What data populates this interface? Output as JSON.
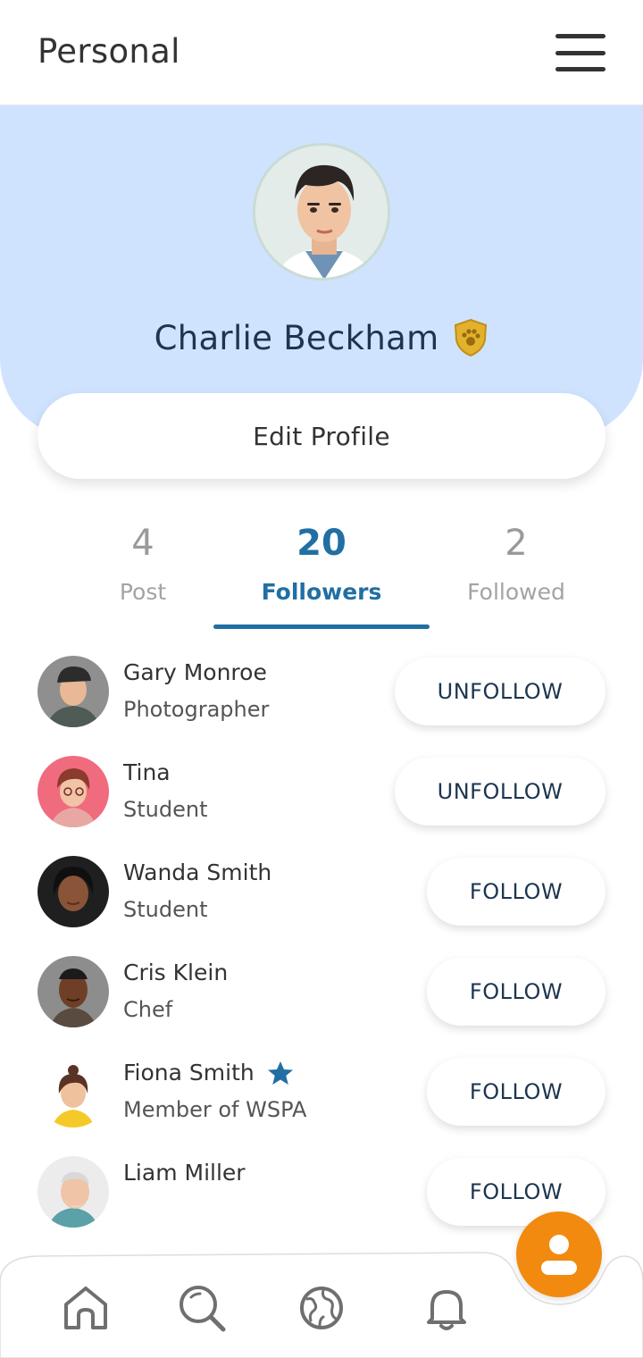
{
  "header": {
    "title": "Personal",
    "menu_icon": "hamburger-menu-icon"
  },
  "profile": {
    "name": "Charlie Beckham",
    "badge_icon": "gold-shield-paw-icon",
    "edit_label": "Edit Profile",
    "band_color": "#cfe3ff"
  },
  "stats": [
    {
      "count": "4",
      "label": "Post"
    },
    {
      "count": "20",
      "label": "Followers"
    },
    {
      "count": "2",
      "label": "Followed"
    }
  ],
  "active_tab": "Followers",
  "people": [
    {
      "name": "Gary Monroe",
      "role": "Photographer",
      "action": "UNFOLLOW"
    },
    {
      "name": "Tina",
      "role": "Student",
      "action": "UNFOLLOW"
    },
    {
      "name": "Wanda Smith",
      "role": "Student",
      "action": "FOLLOW"
    },
    {
      "name": "Cris Klein",
      "role": "Chef",
      "action": "FOLLOW"
    },
    {
      "name": "Fiona Smith",
      "role": "Member of WSPA",
      "action": "FOLLOW",
      "badge_icon": "star-icon"
    },
    {
      "name": "Liam Miller",
      "role": "",
      "action": "FOLLOW"
    }
  ],
  "bottom_nav": [
    "home-icon",
    "search-icon",
    "globe-icon",
    "bell-icon"
  ],
  "fab_icon": "profile-person-icon",
  "colors": {
    "accent": "#216fa3",
    "fab": "#f28a10",
    "name_text": "#1d3550"
  }
}
